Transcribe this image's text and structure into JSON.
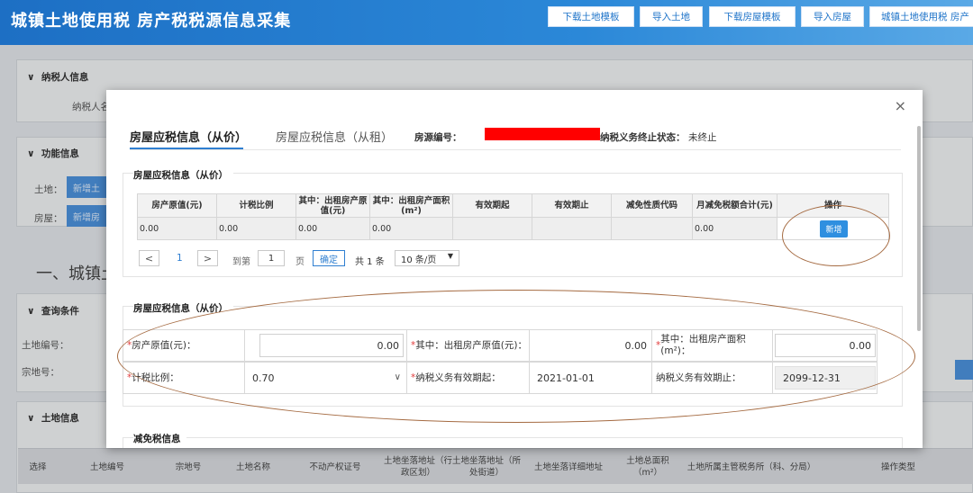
{
  "header": {
    "title": "城镇土地使用税 房产税税源信息采集",
    "buttons": [
      "下载土地模板",
      "导入土地",
      "下载房屋模板",
      "导入房屋",
      "城镇土地使用税 房产"
    ]
  },
  "background": {
    "section_taxpayer": "纳税人信息",
    "taxpayer_partial": "纳税人名",
    "section_function": "功能信息",
    "land_label": "土地：",
    "house_label": "房屋：",
    "add_partial_1": "新增土",
    "add_partial_2": "新增房",
    "big_heading": "一、城镇土",
    "section_query": "查询条件",
    "land_no_label": "土地编号：",
    "parcel_no_label": "宗地号：",
    "section_land": "土地信息",
    "land_table_headers": [
      "选择",
      "土地编号",
      "宗地号",
      "土地名称",
      "不动产权证号",
      "土地坐落地址（行政区划）",
      "土地坐落地址（所处街道）",
      "土地坐落详细地址",
      "土地总面积（m²）",
      "土地所属主管税务所（科、分局）",
      "操作类型"
    ]
  },
  "modal": {
    "close": "×",
    "tab_active": "房屋应税信息（从价）",
    "tab_other": "房屋应税信息（从租）",
    "source_no_label": "房源编号：",
    "status_label": "纳税义务终止状态：",
    "status_value": "未终止",
    "panel1_title": "房屋应税信息（从价）",
    "table": {
      "headers": [
        "房产原值(元)",
        "计税比例",
        "其中：出租房产原值(元)",
        "其中：出租房产面积(m²)",
        "有效期起",
        "有效期止",
        "减免性质代码",
        "月减免税额合计(元)",
        "操作"
      ],
      "row": [
        "0.00",
        "0.00",
        "0.00",
        "0.00",
        "",
        "",
        "",
        "0.00"
      ],
      "add_button": "新增"
    },
    "pager": {
      "prev": "<",
      "page": "1",
      "next": ">",
      "goto_label": "到第",
      "goto_value": "1",
      "page_unit": "页",
      "confirm": "确定",
      "total": "共 1 条",
      "page_size": "10 条/页"
    },
    "panel2_title": "房屋应税信息（从价）",
    "form": {
      "original_value_label": "房产原值(元)：",
      "original_value": "0.00",
      "rent_value_label": "其中：出租房产原值(元)：",
      "rent_value": "0.00",
      "rent_area_label": "其中：出租房产面积(m²)：",
      "rent_area": "0.00",
      "ratio_label": "计税比例：",
      "ratio_value": "0.70",
      "start_label": "纳税义务有效期起：",
      "start_value": "2021-01-01",
      "end_label": "纳税义务有效期止：",
      "end_value": "2099-12-31"
    },
    "panel3_title": "减免税信息"
  }
}
